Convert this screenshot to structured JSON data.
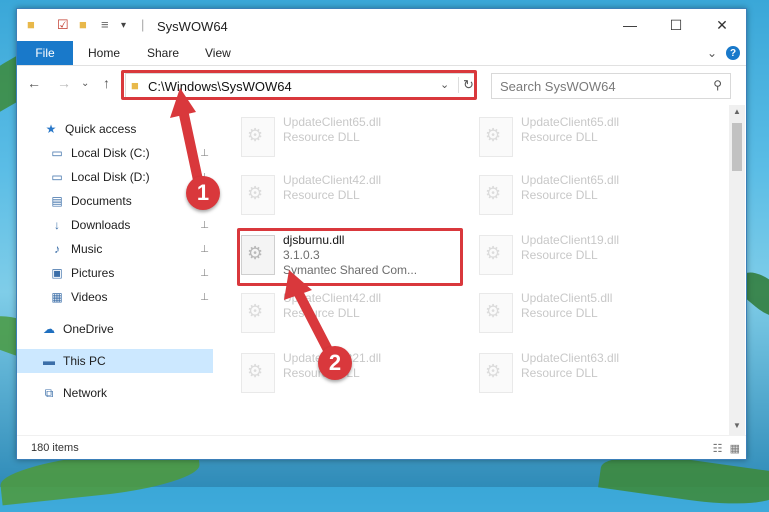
{
  "window": {
    "title": "SysWOW64",
    "controls": {
      "minimize": "—",
      "maximize": "☐",
      "close": "✕"
    }
  },
  "ribbon": {
    "tabs": [
      "File",
      "Home",
      "Share",
      "View"
    ],
    "expand": "⌄",
    "help": "?"
  },
  "navigation": {
    "back": "←",
    "forward": "→",
    "dropdown": "⌄",
    "up": "↑",
    "address": "C:\\Windows\\SysWOW64",
    "refresh": "↻",
    "search_placeholder": "Search SysWOW64"
  },
  "sidebar": {
    "items": [
      {
        "label": "Quick access",
        "icon": "star-icon",
        "glyph": "★"
      },
      {
        "label": "Local Disk (C:)",
        "icon": "drive-icon",
        "glyph": "▭"
      },
      {
        "label": "Local Disk (D:)",
        "icon": "drive-icon",
        "glyph": "▭"
      },
      {
        "label": "Documents",
        "icon": "documents-icon",
        "glyph": "▤"
      },
      {
        "label": "Downloads",
        "icon": "download-icon",
        "glyph": "↓"
      },
      {
        "label": "Music",
        "icon": "music-icon",
        "glyph": "♪"
      },
      {
        "label": "Pictures",
        "icon": "pictures-icon",
        "glyph": "▣"
      },
      {
        "label": "Videos",
        "icon": "videos-icon",
        "glyph": "▦"
      },
      {
        "label": "OneDrive",
        "icon": "cloud-icon",
        "glyph": "☁"
      },
      {
        "label": "This PC",
        "icon": "computer-icon",
        "glyph": "▬"
      },
      {
        "label": "Network",
        "icon": "network-icon",
        "glyph": "⧉"
      }
    ],
    "pin": "📌"
  },
  "files": {
    "left": [
      {
        "name": "UpdateClient65.dll",
        "type": "Resource DLL"
      },
      {
        "name": "UpdateClient42.dll",
        "type": "Resource DLL"
      },
      {
        "name": "djsburnu.dll",
        "version": "3.1.0.3",
        "company": "Symantec Shared Com..."
      },
      {
        "name": "UpdateClient42.dll",
        "type": "Resource DLL"
      },
      {
        "name": "UpdateClient21.dll",
        "type": "Resource DLL"
      }
    ],
    "right": [
      {
        "name": "UpdateClient65.dll",
        "type": "Resource DLL"
      },
      {
        "name": "UpdateClient65.dll",
        "type": "Resource DLL"
      },
      {
        "name": "UpdateClient19.dll",
        "type": "Resource DLL"
      },
      {
        "name": "UpdateClient5.dll",
        "type": "Resource DLL"
      },
      {
        "name": "UpdateClient63.dll",
        "type": "Resource DLL"
      }
    ]
  },
  "status": {
    "items": "180 items"
  },
  "callouts": [
    "1",
    "2"
  ],
  "colors": {
    "accent": "#1979ca",
    "highlight": "#d9383c",
    "selected": "#cce8ff"
  }
}
